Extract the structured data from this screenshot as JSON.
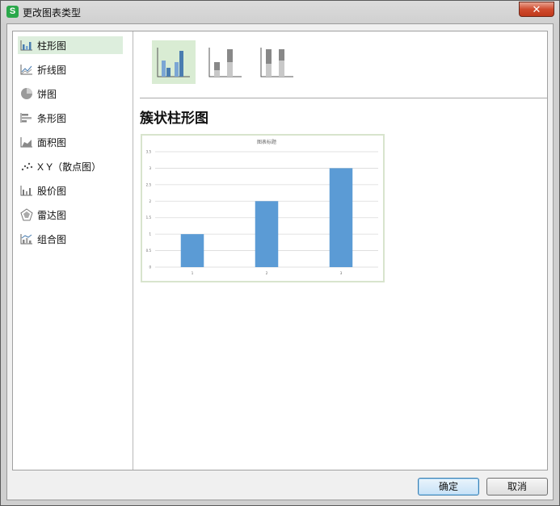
{
  "window": {
    "title": "更改图表类型",
    "app_icon_glyph": "S",
    "close_glyph": "✕"
  },
  "sidebar": {
    "items": [
      {
        "label": "柱形图",
        "icon": "column-chart-icon",
        "selected": true
      },
      {
        "label": "折线图",
        "icon": "line-chart-icon",
        "selected": false
      },
      {
        "label": "饼图",
        "icon": "pie-chart-icon",
        "selected": false
      },
      {
        "label": "条形图",
        "icon": "bar-chart-icon",
        "selected": false
      },
      {
        "label": "面积图",
        "icon": "area-chart-icon",
        "selected": false
      },
      {
        "label": "X Y（散点图）",
        "icon": "scatter-chart-icon",
        "selected": false
      },
      {
        "label": "股价图",
        "icon": "stock-chart-icon",
        "selected": false
      },
      {
        "label": "雷达图",
        "icon": "radar-chart-icon",
        "selected": false
      },
      {
        "label": "组合图",
        "icon": "combo-chart-icon",
        "selected": false
      }
    ]
  },
  "subtypes": [
    {
      "icon": "clustered-column-icon",
      "selected": true
    },
    {
      "icon": "stacked-column-icon",
      "selected": false
    },
    {
      "icon": "percent-stacked-column-icon",
      "selected": false
    }
  ],
  "section_title": "簇状柱形图",
  "chart_data": {
    "type": "bar",
    "title": "图表标题",
    "categories": [
      "1",
      "2",
      "3"
    ],
    "values": [
      1,
      2,
      3
    ],
    "ylim": [
      0,
      3.5
    ],
    "yticks": [
      "0",
      "0.5",
      "1",
      "1.5",
      "2",
      "2.5",
      "3",
      "3.5"
    ],
    "grid": true,
    "bar_color": "#5b9bd5"
  },
  "buttons": {
    "ok": "确定",
    "cancel": "取消"
  },
  "colors": {
    "selected_bg": "#ddeedd",
    "accent_blue": "#5b9bd5"
  }
}
